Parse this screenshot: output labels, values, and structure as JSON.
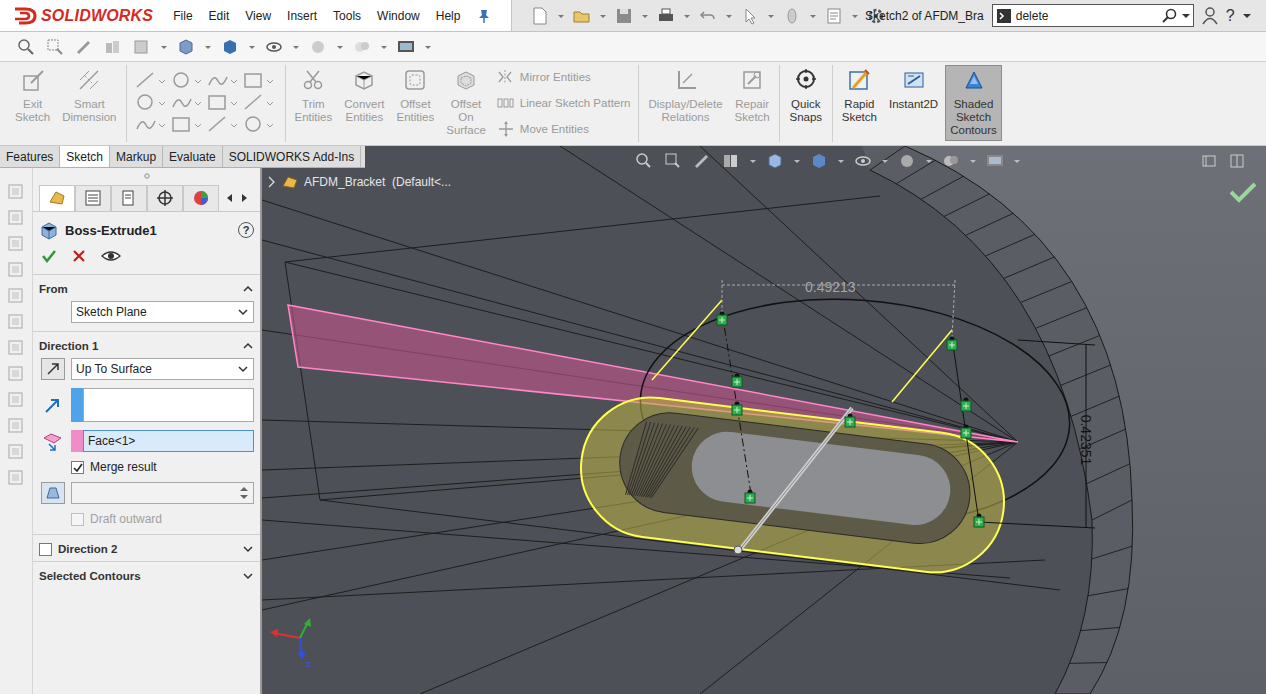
{
  "app": {
    "brand": "SOLIDWORKS"
  },
  "menu": [
    "File",
    "Edit",
    "View",
    "Insert",
    "Tools",
    "Window",
    "Help"
  ],
  "window": {
    "title": "Sketch2 of AFDM_Bra"
  },
  "search": {
    "value": "delete"
  },
  "help_button": "?",
  "ribbon": [
    [
      {
        "kind": "big",
        "lines": [
          "Exit",
          "Sketch"
        ],
        "disabled": true,
        "selected": false
      },
      {
        "kind": "big",
        "lines": [
          "Smart",
          "Dimension"
        ],
        "disabled": true,
        "selected": false
      }
    ],
    [
      {
        "kind": "grid",
        "disabled": true,
        "selected": false
      }
    ],
    [
      {
        "kind": "big",
        "lines": [
          "Trim",
          "Entities"
        ],
        "disabled": true,
        "selected": false
      },
      {
        "kind": "big",
        "lines": [
          "Convert",
          "Entities"
        ],
        "disabled": true,
        "selected": false
      },
      {
        "kind": "big",
        "lines": [
          "Offset",
          "Entities"
        ],
        "disabled": true,
        "selected": false
      },
      {
        "kind": "big",
        "lines": [
          "Offset",
          "On",
          "Surface"
        ],
        "disabled": true,
        "selected": false
      },
      {
        "kind": "stack",
        "items": [
          {
            "label": "Mirror Entities",
            "disabled": true
          },
          {
            "label": "Linear Sketch Pattern",
            "disabled": true
          },
          {
            "label": "Move Entities",
            "disabled": true
          }
        ]
      }
    ],
    [
      {
        "kind": "big",
        "lines": [
          "Display/Delete",
          "Relations"
        ],
        "disabled": true,
        "selected": false
      },
      {
        "kind": "big",
        "lines": [
          "Repair",
          "Sketch"
        ],
        "disabled": true,
        "selected": false
      }
    ],
    [
      {
        "kind": "big",
        "lines": [
          "Quick",
          "Snaps"
        ],
        "disabled": false,
        "selected": false
      }
    ],
    [
      {
        "kind": "big",
        "lines": [
          "Rapid",
          "Sketch"
        ],
        "disabled": false,
        "selected": false
      },
      {
        "kind": "big",
        "lines": [
          "Instant2D"
        ],
        "disabled": false,
        "selected": false
      },
      {
        "kind": "big",
        "lines": [
          "Shaded",
          "Sketch",
          "Contours"
        ],
        "disabled": false,
        "selected": true
      }
    ]
  ],
  "tabs": [
    {
      "label": "Features",
      "selected": false
    },
    {
      "label": "Sketch",
      "selected": true
    },
    {
      "label": "Markup",
      "selected": false
    },
    {
      "label": "Evaluate",
      "selected": false
    },
    {
      "label": "SOLIDWORKS Add-Ins",
      "selected": false
    }
  ],
  "property_manager": {
    "title": "Boss-Extrude1",
    "help": "?",
    "from": {
      "label": "From",
      "expanded": true,
      "value": "Sketch Plane"
    },
    "direction1": {
      "label": "Direction 1",
      "expanded": true,
      "end_condition": "Up To Surface",
      "direction_value": "",
      "face_value": "Face<1>",
      "face_focused": true,
      "merge": {
        "label": "Merge result",
        "checked": true
      },
      "depth_value": "",
      "draft": {
        "label": "Draft outward",
        "checked": false,
        "disabled": true
      }
    },
    "direction2": {
      "label": "Direction 2",
      "checked": false,
      "expanded": false
    },
    "contours": {
      "label": "Selected Contours",
      "expanded": false
    }
  },
  "feature_tree": {
    "label": "AFDM_Bracket  (Default<...",
    "expanded": false
  },
  "dimensions": [
    {
      "value": "0.49213",
      "kind": "horizontal",
      "greyed": true
    },
    {
      "value": "0.42351",
      "kind": "vertical",
      "greyed": false
    }
  ],
  "triad": {
    "label": "Z"
  }
}
